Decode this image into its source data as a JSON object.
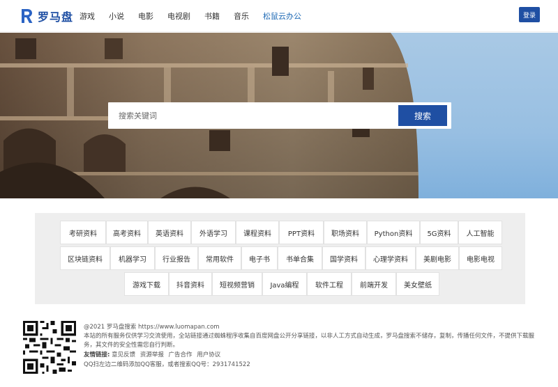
{
  "brand": {
    "name": "罗马盘",
    "color": "#1f4fa3"
  },
  "nav": {
    "items": [
      {
        "label": "游戏"
      },
      {
        "label": "小说"
      },
      {
        "label": "电影"
      },
      {
        "label": "电视剧"
      },
      {
        "label": "书籍"
      },
      {
        "label": "音乐"
      },
      {
        "label": "松鼠云办公"
      }
    ],
    "login_label": "登录"
  },
  "search": {
    "placeholder": "搜索关键词",
    "button_label": "搜索"
  },
  "tags": [
    "考研资料",
    "高考资料",
    "英语资料",
    "外语学习",
    "课程资料",
    "PPT资料",
    "职场资料",
    "Python资料",
    "5G资料",
    "人工智能",
    "区块链资料",
    "机器学习",
    "行业报告",
    "常用软件",
    "电子书",
    "书单合集",
    "国学资料",
    "心理学资料",
    "美剧电影",
    "电影电视",
    "游戏下载",
    "抖音资料",
    "短视频营销",
    "Java编程",
    "软件工程",
    "前端开发",
    "美女壁纸"
  ],
  "footer": {
    "copyright": "@2021 罗马盘搜索 https://www.luomapan.com",
    "disclaimer": "本站的所有服务仅供学习交流使用，全站链接通过蜘蛛程序收集自百度网盘公开分享链接，以非人工方式自动生成，罗马盘搜索不储存，复制，传播任何文件，不提供下载服务，其文件的安全性需您自行判断。",
    "links_label": "友情链接:",
    "links": [
      "意见反馈",
      "资源举报",
      "广告合作",
      "用户协议"
    ],
    "qq_text": "QQ扫左边二维码添加QQ客服，或者搜索QQ号：2931741522"
  }
}
